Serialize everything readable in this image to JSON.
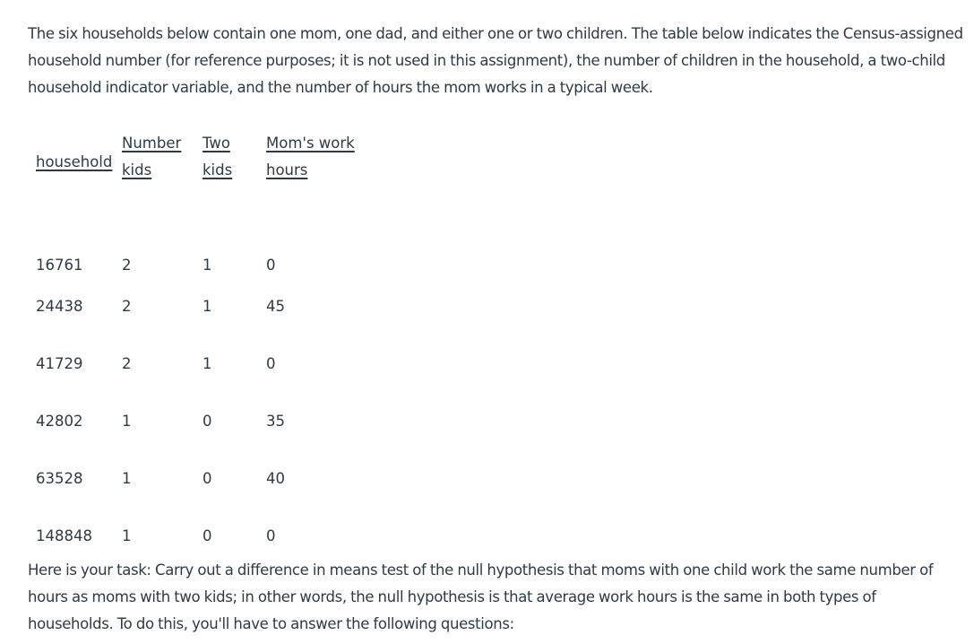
{
  "intro_paragraph": "The six households below contain one mom, one dad, and either one or two children.  The table below indicates the Census-assigned household number (for reference purposes; it is not used in this assignment), the number of children in the household, a two-child household indicator variable, and the number of hours the mom works in a typical week.",
  "table": {
    "headers": [
      {
        "line1": "household",
        "line2": ""
      },
      {
        "line1": "Number",
        "line2": "kids"
      },
      {
        "line1": "Two",
        "line2": "kids"
      },
      {
        "line1": "Mom's work",
        "line2": "hours"
      }
    ],
    "rows": [
      {
        "household": "16761",
        "number_kids": "2",
        "two_kids": "1",
        "mom_work_hours": "0"
      },
      {
        "household": "24438",
        "number_kids": "2",
        "two_kids": "1",
        "mom_work_hours": "45"
      },
      {
        "household": "41729",
        "number_kids": "2",
        "two_kids": "1",
        "mom_work_hours": "0"
      },
      {
        "household": "42802",
        "number_kids": "1",
        "two_kids": "0",
        "mom_work_hours": "35"
      },
      {
        "household": "63528",
        "number_kids": "1",
        "two_kids": "0",
        "mom_work_hours": "40"
      },
      {
        "household": "148848",
        "number_kids": "1",
        "two_kids": "0",
        "mom_work_hours": "0"
      }
    ]
  },
  "task_paragraph": "Here is your task: Carry out a difference in means test of the null hypothesis that moms with one child work the same number of hours as moms with two kids; in other words, the null hypothesis is that average work hours is the same in both types of households.  To do this, you'll have to answer the following questions:"
}
